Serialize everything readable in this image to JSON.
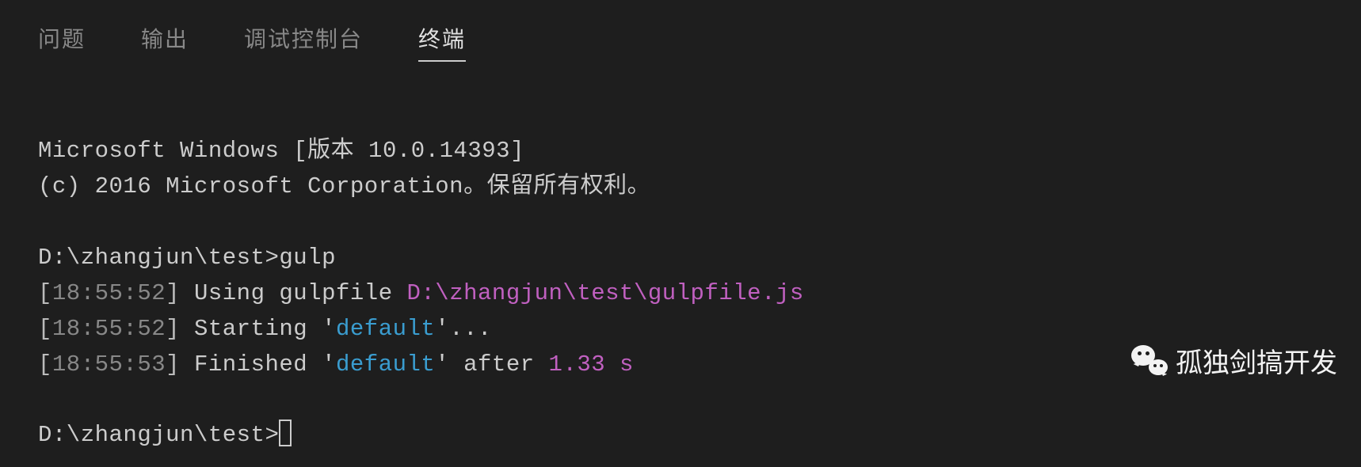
{
  "tabs": {
    "problems": "问题",
    "output": "输出",
    "debug_console": "调试控制台",
    "terminal": "终端"
  },
  "terminal": {
    "banner1": "Microsoft Windows [版本 10.0.14393]",
    "banner2": "(c) 2016 Microsoft Corporation。保留所有权利。",
    "prompt1_path": "D:\\zhangjun\\test>",
    "prompt1_cmd": "gulp",
    "line1": {
      "br_open": "[",
      "time": "18:55:52",
      "br_close": "] ",
      "text": "Using gulpfile ",
      "path": "D:\\zhangjun\\test\\gulpfile.js"
    },
    "line2": {
      "br_open": "[",
      "time": "18:55:52",
      "br_close": "] ",
      "text1": "Starting '",
      "task": "default",
      "text2": "'..."
    },
    "line3": {
      "br_open": "[",
      "time": "18:55:53",
      "br_close": "] ",
      "text1": "Finished '",
      "task": "default",
      "text2": "' after ",
      "dur": "1.33 s"
    },
    "prompt2_path": "D:\\zhangjun\\test>"
  },
  "watermark": {
    "text": "孤独剑搞开发"
  }
}
